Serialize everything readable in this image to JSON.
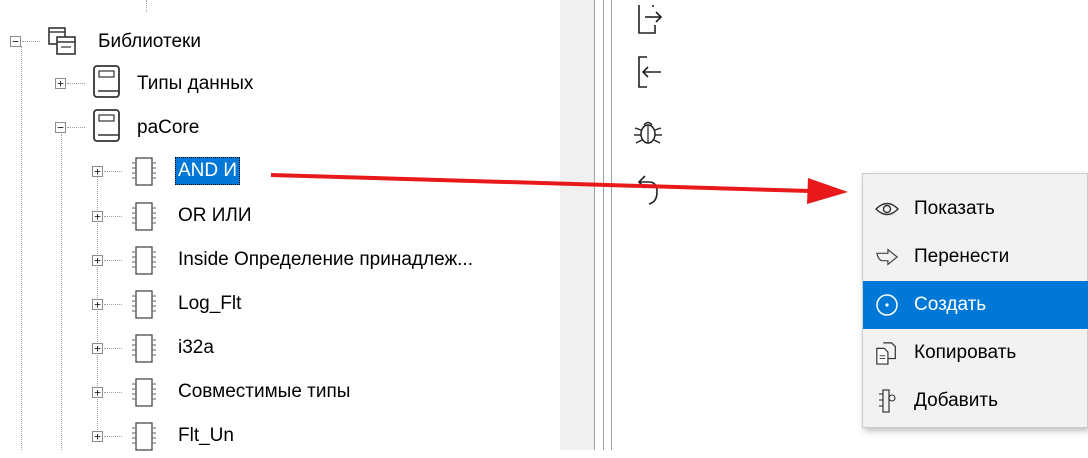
{
  "tree": {
    "root": {
      "label": "Библиотеки",
      "expander": "−"
    },
    "libraries": [
      {
        "label": "Типы данных",
        "expander": "+"
      },
      {
        "label": "paCore",
        "expander": "−"
      }
    ],
    "items": [
      {
        "label": "AND И",
        "expander": "+",
        "selected": true
      },
      {
        "label": "OR ИЛИ",
        "expander": "+"
      },
      {
        "label": "Inside Определение принадлеж...",
        "expander": "+"
      },
      {
        "label": "Log_Flt",
        "expander": "+"
      },
      {
        "label": "i32a",
        "expander": "+"
      },
      {
        "label": "Совместимые типы",
        "expander": "+"
      },
      {
        "label": "Flt_Un",
        "expander": "+"
      }
    ]
  },
  "toolbar": {
    "buttons": [
      "export-icon",
      "import-icon",
      "debug-bug-icon",
      "undo-icon"
    ]
  },
  "context_menu": {
    "items": [
      {
        "label": "Показать",
        "icon": "eye-icon"
      },
      {
        "label": "Перенести",
        "icon": "move-arrow-icon"
      },
      {
        "label": "Создать",
        "icon": "create-circle-icon",
        "active": true
      },
      {
        "label": "Копировать",
        "icon": "copy-icon"
      },
      {
        "label": "Добавить",
        "icon": "add-component-icon"
      }
    ]
  },
  "colors": {
    "selection": "#0078d7",
    "annotation_arrow": "#e8191b",
    "menu_background": "#f2f2f2"
  }
}
